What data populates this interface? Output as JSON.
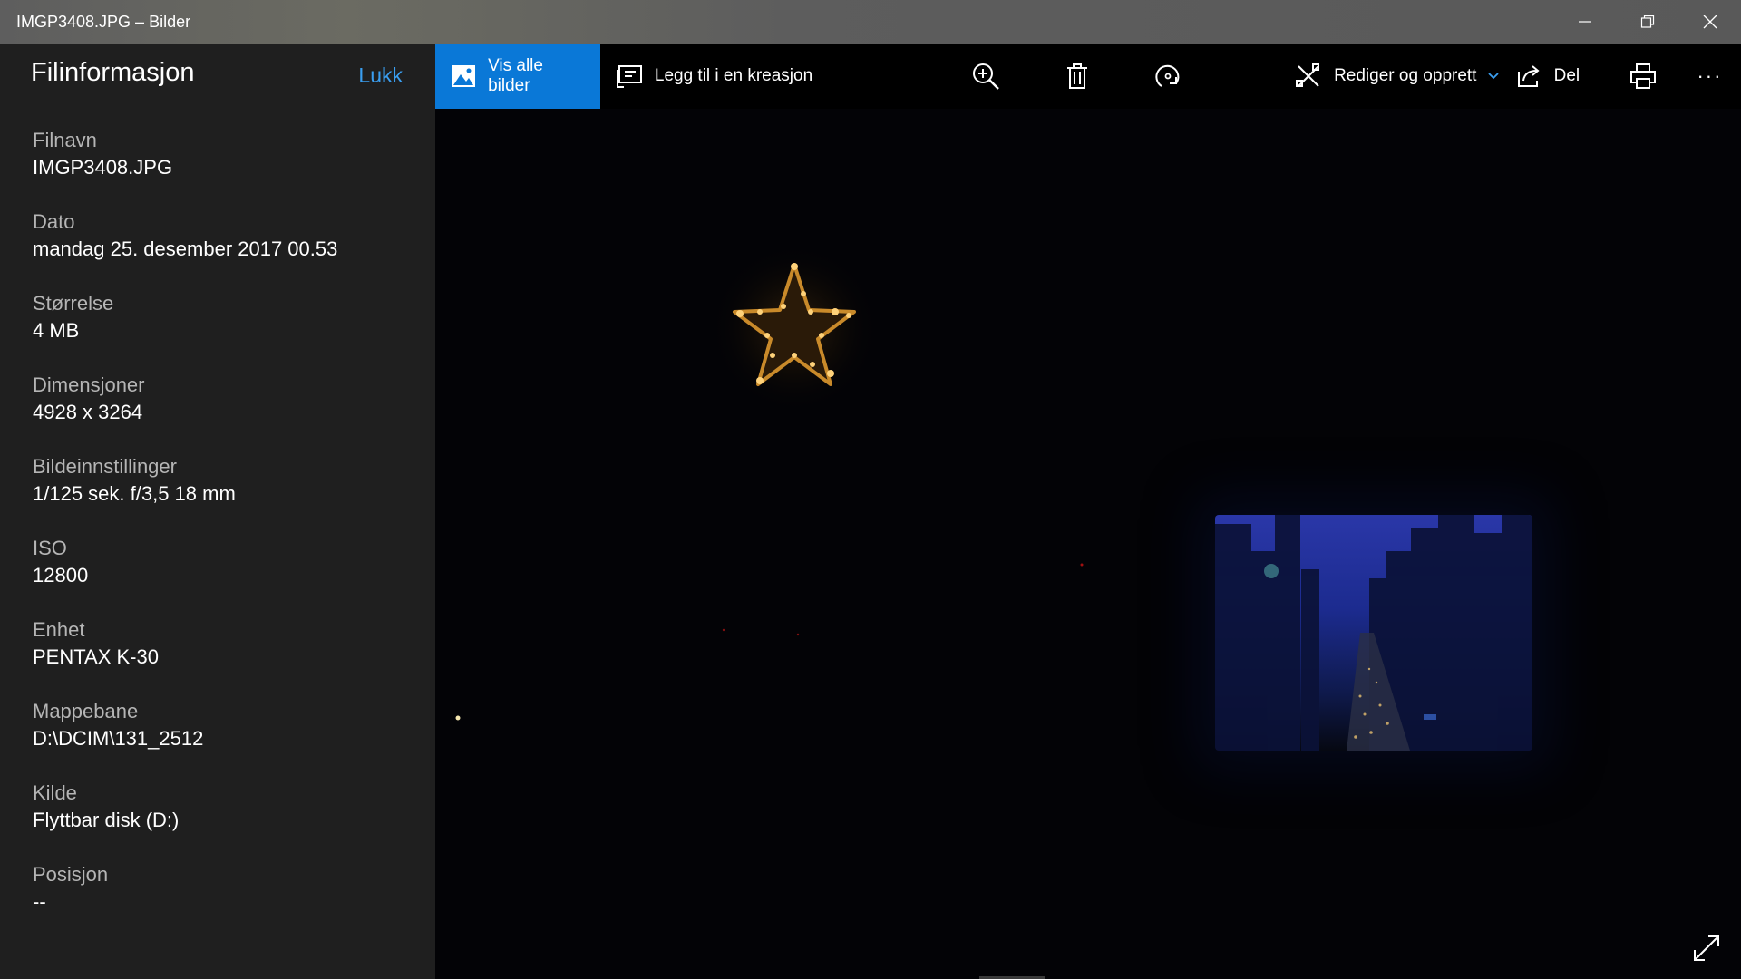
{
  "window": {
    "title": "IMGP3408.JPG – Bilder"
  },
  "panel": {
    "title": "Filinformasjon",
    "close_label": "Lukk",
    "items": [
      {
        "label": "Filnavn",
        "value": "IMGP3408.JPG"
      },
      {
        "label": "Dato",
        "value": "mandag 25. desember 2017 00.53"
      },
      {
        "label": "Størrelse",
        "value": "4 MB"
      },
      {
        "label": "Dimensjoner",
        "value": "4928 x 3264"
      },
      {
        "label": "Bildeinnstillinger",
        "value": "1/125 sek. f/3,5 18 mm"
      },
      {
        "label": "ISO",
        "value": "12800"
      },
      {
        "label": "Enhet",
        "value": "PENTAX K-30"
      },
      {
        "label": "Mappebane",
        "value": "D:\\DCIM\\131_2512"
      },
      {
        "label": "Kilde",
        "value": "Flyttbar disk (D:)"
      },
      {
        "label": "Posisjon",
        "value": "--"
      }
    ]
  },
  "toolbar": {
    "view_all": "Vis alle bilder",
    "add_to_creation": "Legg til i en kreasjon",
    "edit_create": "Rediger og opprett",
    "share": "Del",
    "more": "···"
  },
  "colors": {
    "accent": "#0a78d7",
    "link": "#3a9ef0",
    "panel_bg": "#1f1f1f"
  }
}
